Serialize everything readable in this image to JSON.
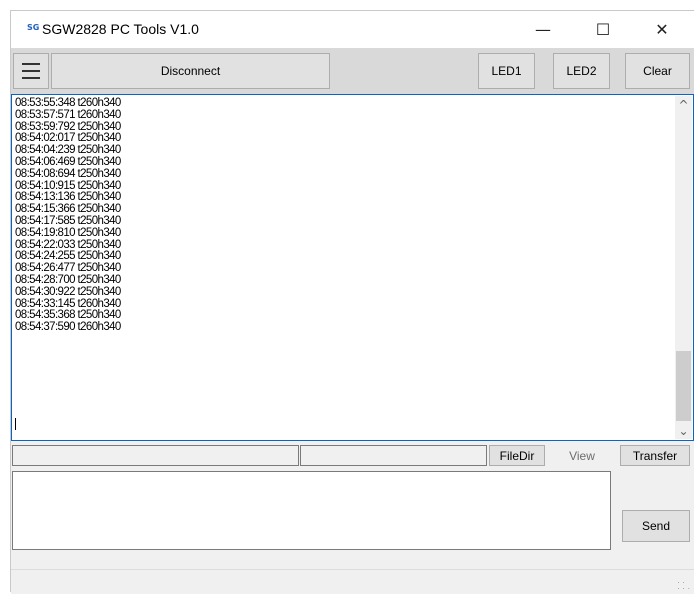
{
  "window": {
    "title": "SGW2828 PC Tools V1.0",
    "app_icon_text": "SG",
    "minimize_glyph": "—",
    "maximize_glyph": "☐",
    "close_glyph": "✕"
  },
  "toolbar": {
    "menu_icon": "hamburger-icon",
    "disconnect_label": "Disconnect",
    "led1_label": "LED1",
    "led2_label": "LED2",
    "clear_label": "Clear"
  },
  "log": {
    "lines": [
      "08:53:55:348 t260h340",
      "08:53:57:571 t260h340",
      "08:53:59:792 t250h340",
      "08:54:02:017 t250h340",
      "08:54:04:239 t250h340",
      "08:54:06:469 t250h340",
      "08:54:08:694 t250h340",
      "08:54:10:915 t250h340",
      "08:54:13:136 t250h340",
      "08:54:15:366 t250h340",
      "08:54:17:585 t250h340",
      "08:54:19:810 t250h340",
      "08:54:22:033 t250h340",
      "08:54:24:255 t250h340",
      "08:54:26:477 t250h340",
      "08:54:28:700 t250h340",
      "08:54:30:922 t250h340",
      "08:54:33:145 t260h340",
      "08:54:35:368 t250h340",
      "08:54:37:590 t260h340"
    ],
    "scroll_up_glyph": "^",
    "scroll_down_glyph": "⌄"
  },
  "file_bar": {
    "path_value": "",
    "name_value": "",
    "filedir_label": "FileDir",
    "view_label": "View",
    "transfer_label": "Transfer"
  },
  "send": {
    "input_value": "",
    "send_label": "Send"
  },
  "colors": {
    "accent": "#0a64c8",
    "disabled_text": "#6d6d6d"
  }
}
